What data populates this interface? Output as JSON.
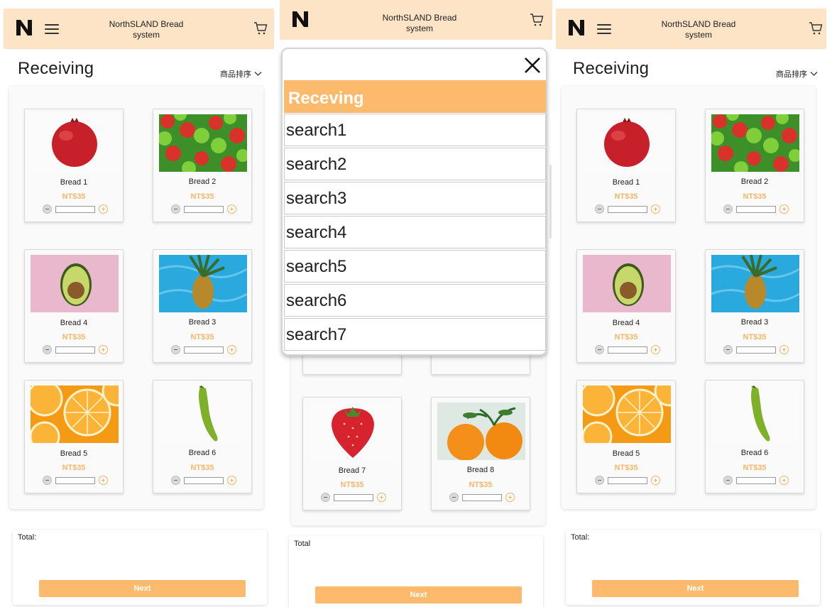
{
  "app": {
    "title_line1": "NorthSLAND Bread",
    "title_line2": "system",
    "logo_letter": "N"
  },
  "page": {
    "title": "Receiving",
    "sort_label": "商品排序"
  },
  "products": [
    {
      "name": "Bread 1",
      "price": "NT$35",
      "image": "pomegranate"
    },
    {
      "name": "Bread 2",
      "price": "NT$35",
      "image": "apples"
    },
    {
      "name": "Bread 4",
      "price": "NT$35",
      "image": "avocado"
    },
    {
      "name": "Bread 3",
      "price": "NT$35",
      "image": "pineapple"
    },
    {
      "name": "Bread 5",
      "price": "NT$35",
      "image": "orange-slices"
    },
    {
      "name": "Bread 6",
      "price": "NT$35",
      "image": "green-pepper"
    }
  ],
  "middle_products": [
    {
      "name": "Bread 7",
      "price": "NT$35",
      "image": "strawberry"
    },
    {
      "name": "Bread 8",
      "price": "NT$35",
      "image": "tangerines"
    }
  ],
  "total": {
    "label_left": "Total:",
    "label_middle": "Total",
    "next_label": "Next"
  },
  "modal": {
    "header": "Receving",
    "items": [
      "search1",
      "search2",
      "search3",
      "search4",
      "search5",
      "search6",
      "search7"
    ]
  },
  "colors": {
    "header_bg": "#fde4c6",
    "accent": "#fdba6c",
    "price": "#f7b76a"
  }
}
